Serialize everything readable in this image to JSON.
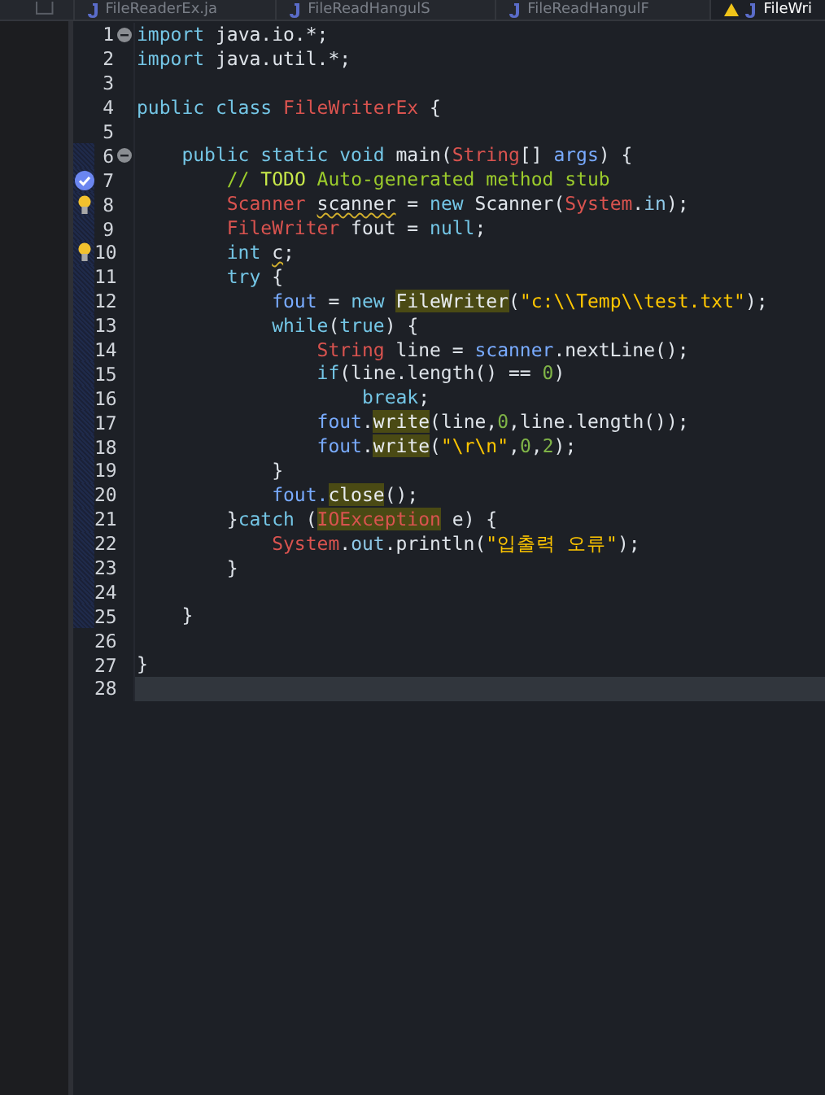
{
  "tabs": [
    {
      "label": "FileReaderEx.ja",
      "selected": false,
      "warning": false
    },
    {
      "label": "FileReadHangulS",
      "selected": false,
      "warning": false
    },
    {
      "label": "FileReadHangulF",
      "selected": false,
      "warning": false
    },
    {
      "label": "FileWri",
      "selected": true,
      "warning": true
    }
  ],
  "editor": {
    "lines": [
      {
        "kind": "normal",
        "number": "1",
        "markers": [
          {
            "kind": "collapse"
          }
        ],
        "in_range": false,
        "tokens": [
          {
            "kind": "keyword",
            "text": "import"
          },
          {
            "kind": "plain",
            "text": " java.io.*;"
          }
        ]
      },
      {
        "kind": "normal",
        "number": "2",
        "in_range": false,
        "tokens": [
          {
            "kind": "keyword",
            "text": "import"
          },
          {
            "kind": "plain",
            "text": " java.util.*;"
          }
        ]
      },
      {
        "kind": "normal",
        "number": "3",
        "in_range": false
      },
      {
        "kind": "normal",
        "number": "4",
        "in_range": false,
        "tokens": [
          {
            "kind": "keyword",
            "text": "public class "
          },
          {
            "kind": "type",
            "text": "FileWriterEx"
          },
          {
            "kind": "plain",
            "text": " {"
          }
        ]
      },
      {
        "kind": "normal",
        "number": "5",
        "in_range": false
      },
      {
        "kind": "normal",
        "number": "6",
        "markers": [
          {
            "kind": "collapse"
          }
        ],
        "in_range": true,
        "tokens": [
          {
            "kind": "keyword",
            "text": "    public static void"
          },
          {
            "kind": "plain",
            "text": " main("
          },
          {
            "kind": "type",
            "text": "String"
          },
          {
            "kind": "plain",
            "text": "[] "
          },
          {
            "kind": "variable",
            "text": "args"
          },
          {
            "kind": "plain",
            "text": ") {"
          }
        ]
      },
      {
        "kind": "normal",
        "number": "7",
        "markers": [
          {
            "kind": "task"
          }
        ],
        "in_range": true,
        "tokens": [
          {
            "kind": "comment",
            "text": "        // "
          },
          {
            "kind": "task_tag",
            "text": "TODO"
          },
          {
            "kind": "comment",
            "text": " Auto-generated method stub"
          }
        ]
      },
      {
        "kind": "normal",
        "number": "8",
        "markers": [
          {
            "kind": "quick_fix"
          }
        ],
        "in_range": true,
        "tokens": [
          {
            "kind": "type",
            "text": "        Scanner "
          },
          {
            "kind": "warning",
            "text": "scanner"
          },
          {
            "kind": "plain",
            "text": " = "
          },
          {
            "kind": "keyword",
            "text": "new"
          },
          {
            "kind": "plain",
            "text": " Scanner("
          },
          {
            "kind": "type",
            "text": "System"
          },
          {
            "kind": "plain",
            "text": "."
          },
          {
            "kind": "field",
            "text": "in"
          },
          {
            "kind": "plain",
            "text": ");"
          }
        ]
      },
      {
        "kind": "normal",
        "number": "9",
        "in_range": true,
        "tokens": [
          {
            "kind": "type",
            "text": "        FileWriter"
          },
          {
            "kind": "plain",
            "text": " fout = "
          },
          {
            "kind": "keyword",
            "text": "null"
          },
          {
            "kind": "plain",
            "text": ";"
          }
        ]
      },
      {
        "kind": "normal",
        "number": "10",
        "markers": [
          {
            "kind": "quick_fix"
          }
        ],
        "in_range": true,
        "tokens": [
          {
            "kind": "keyword",
            "text": "        int "
          },
          {
            "kind": "warning",
            "text": "c"
          },
          {
            "kind": "plain",
            "text": ";"
          }
        ]
      },
      {
        "kind": "normal",
        "number": "11",
        "in_range": true,
        "tokens": [
          {
            "kind": "keyword",
            "text": "        try"
          },
          {
            "kind": "plain",
            "text": " {"
          }
        ]
      },
      {
        "kind": "normal",
        "number": "12",
        "in_range": true,
        "tokens": [
          {
            "kind": "variable",
            "text": "            fout"
          },
          {
            "kind": "plain",
            "text": " = "
          },
          {
            "kind": "keyword",
            "text": "new "
          },
          {
            "kind": "occurrence",
            "text": "FileWriter"
          },
          {
            "kind": "plain",
            "text": "("
          },
          {
            "kind": "string",
            "text": "\"c:\\\\Temp\\\\test.txt\""
          },
          {
            "kind": "plain",
            "text": ");"
          }
        ]
      },
      {
        "kind": "normal",
        "number": "13",
        "in_range": true,
        "tokens": [
          {
            "kind": "keyword",
            "text": "            while"
          },
          {
            "kind": "plain",
            "text": "("
          },
          {
            "kind": "keyword",
            "text": "true"
          },
          {
            "kind": "plain",
            "text": ") {"
          }
        ]
      },
      {
        "kind": "normal",
        "number": "14",
        "in_range": true,
        "tokens": [
          {
            "kind": "type",
            "text": "                String"
          },
          {
            "kind": "plain",
            "text": " line = "
          },
          {
            "kind": "variable",
            "text": "scanner"
          },
          {
            "kind": "plain",
            "text": ".nextLine();"
          }
        ]
      },
      {
        "kind": "normal",
        "number": "15",
        "in_range": true,
        "tokens": [
          {
            "kind": "keyword",
            "text": "                if"
          },
          {
            "kind": "plain",
            "text": "(line.length() == "
          },
          {
            "kind": "number",
            "text": "0"
          },
          {
            "kind": "plain",
            "text": ")"
          }
        ]
      },
      {
        "kind": "normal",
        "number": "16",
        "in_range": true,
        "tokens": [
          {
            "kind": "keyword",
            "text": "                    break"
          },
          {
            "kind": "plain",
            "text": ";"
          }
        ]
      },
      {
        "kind": "normal",
        "number": "17",
        "in_range": true,
        "tokens": [
          {
            "kind": "variable",
            "text": "                fout"
          },
          {
            "kind": "plain",
            "text": "."
          },
          {
            "kind": "occurrence",
            "text": "write"
          },
          {
            "kind": "plain",
            "text": "(line,"
          },
          {
            "kind": "number",
            "text": "0"
          },
          {
            "kind": "plain",
            "text": ",line.length());"
          }
        ]
      },
      {
        "kind": "normal",
        "number": "18",
        "in_range": true,
        "tokens": [
          {
            "kind": "variable",
            "text": "                fout"
          },
          {
            "kind": "plain",
            "text": "."
          },
          {
            "kind": "occurrence",
            "text": "write"
          },
          {
            "kind": "plain",
            "text": "("
          },
          {
            "kind": "string",
            "text": "\"\\r\\n\""
          },
          {
            "kind": "plain",
            "text": ","
          },
          {
            "kind": "number",
            "text": "0"
          },
          {
            "kind": "plain",
            "text": ","
          },
          {
            "kind": "number",
            "text": "2"
          },
          {
            "kind": "plain",
            "text": ");"
          }
        ]
      },
      {
        "kind": "normal",
        "number": "19",
        "in_range": true,
        "tokens": [
          {
            "kind": "plain",
            "text": "            }"
          }
        ]
      },
      {
        "kind": "normal",
        "number": "20",
        "in_range": true,
        "tokens": [
          {
            "kind": "variable",
            "text": "            fout."
          },
          {
            "kind": "occurrence",
            "text": "close"
          },
          {
            "kind": "plain",
            "text": "();"
          }
        ]
      },
      {
        "kind": "normal",
        "number": "21",
        "in_range": true,
        "tokens": [
          {
            "kind": "plain",
            "text": "        }"
          },
          {
            "kind": "keyword",
            "text": "catch"
          },
          {
            "kind": "plain",
            "text": " ("
          },
          {
            "kind": "type_occurrence",
            "text": "IOException"
          },
          {
            "kind": "plain",
            "text": " e) {"
          }
        ]
      },
      {
        "kind": "normal",
        "number": "22",
        "in_range": true,
        "tokens": [
          {
            "kind": "type",
            "text": "            System"
          },
          {
            "kind": "plain",
            "text": "."
          },
          {
            "kind": "field",
            "text": "out"
          },
          {
            "kind": "plain",
            "text": ".println("
          },
          {
            "kind": "string",
            "text": "\"입출력 오류\""
          },
          {
            "kind": "plain",
            "text": ");"
          }
        ]
      },
      {
        "kind": "normal",
        "number": "23",
        "in_range": true,
        "tokens": [
          {
            "kind": "plain",
            "text": "        }"
          }
        ]
      },
      {
        "kind": "normal",
        "number": "24",
        "in_range": true
      },
      {
        "kind": "normal",
        "number": "25",
        "in_range": true,
        "tokens": [
          {
            "kind": "plain",
            "text": "    }"
          }
        ]
      },
      {
        "kind": "normal",
        "number": "26",
        "in_range": false
      },
      {
        "kind": "normal",
        "number": "27",
        "in_range": false,
        "tokens": [
          {
            "kind": "plain",
            "text": "}"
          }
        ]
      },
      {
        "kind": "current",
        "number": "28",
        "in_range": false
      }
    ]
  }
}
